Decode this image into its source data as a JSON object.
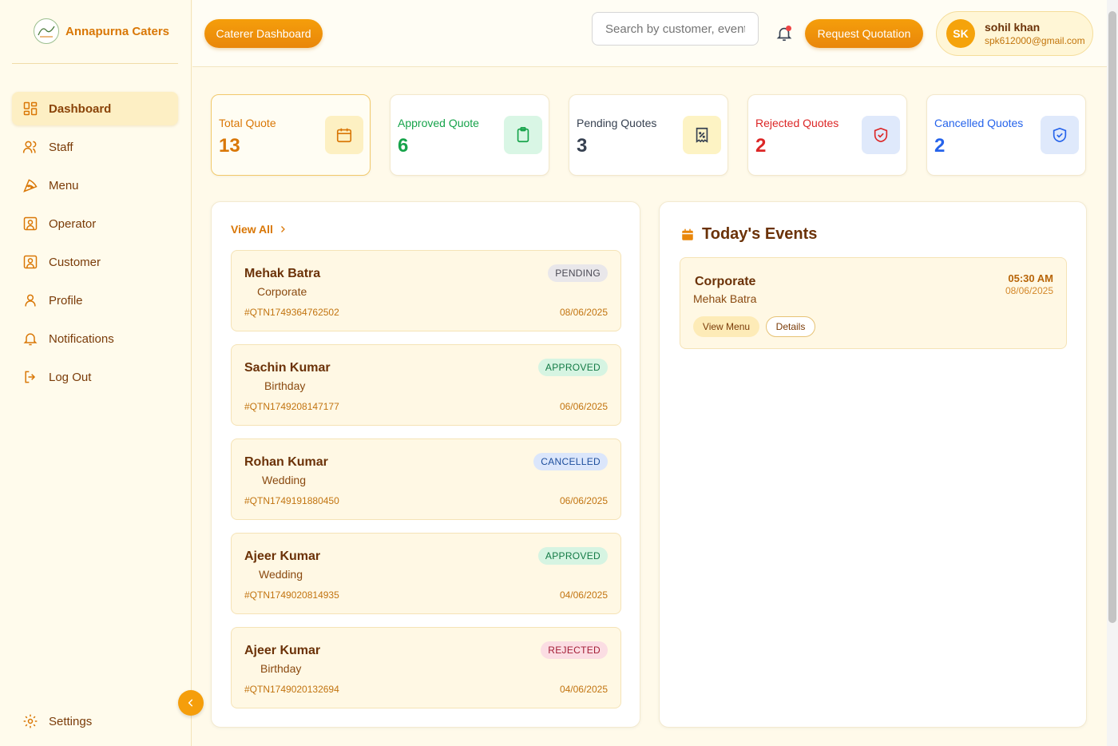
{
  "brand": {
    "name": "Annapurna Caters",
    "logo_text": "Annapurna"
  },
  "sidebar": {
    "items": [
      {
        "label": "Dashboard",
        "icon": "dashboard-icon"
      },
      {
        "label": "Staff",
        "icon": "users-icon"
      },
      {
        "label": "Menu",
        "icon": "pizza-icon"
      },
      {
        "label": "Operator",
        "icon": "id-card-icon"
      },
      {
        "label": "Customer",
        "icon": "id-card-icon"
      },
      {
        "label": "Profile",
        "icon": "user-icon"
      },
      {
        "label": "Notifications",
        "icon": "bell-icon"
      },
      {
        "label": "Log Out",
        "icon": "logout-icon"
      }
    ],
    "settings_label": "Settings"
  },
  "header": {
    "dashboard_button": "Caterer Dashboard",
    "search_placeholder": "Search by customer, event...",
    "request_button": "Request Quotation",
    "user": {
      "initials": "SK",
      "name": "sohil khan",
      "email": "spk612000@gmail.com"
    }
  },
  "stats": [
    {
      "label": "Total Quote",
      "value": "13",
      "color": "#d97706",
      "icon_bg": "#fdf0c2"
    },
    {
      "label": "Approved Quote",
      "value": "6",
      "color": "#16a34a",
      "icon_bg": "#d9f6e5"
    },
    {
      "label": "Pending Quotes",
      "value": "3",
      "color": "#374151",
      "icon_bg": "#fdf3c4"
    },
    {
      "label": "Rejected Quotes",
      "value": "2",
      "color": "#dc2626",
      "icon_bg": "#dfe9fb"
    },
    {
      "label": "Cancelled Quotes",
      "value": "2",
      "color": "#2563eb",
      "icon_bg": "#dfe9fb"
    }
  ],
  "quotes": {
    "view_all": "View All",
    "items": [
      {
        "name": "Mehak Batra",
        "type": "Corporate",
        "id": "#QTN1749364762502",
        "date": "08/06/2025",
        "status": "PENDING"
      },
      {
        "name": "Sachin Kumar",
        "type": "Birthday",
        "id": "#QTN1749208147177",
        "date": "06/06/2025",
        "status": "APPROVED"
      },
      {
        "name": "Rohan Kumar",
        "type": "Wedding",
        "id": "#QTN1749191880450",
        "date": "06/06/2025",
        "status": "CANCELLED"
      },
      {
        "name": "Ajeer Kumar",
        "type": "Wedding",
        "id": "#QTN1749020814935",
        "date": "04/06/2025",
        "status": "APPROVED"
      },
      {
        "name": "Ajeer Kumar",
        "type": "Birthday",
        "id": "#QTN1749020132694",
        "date": "04/06/2025",
        "status": "REJECTED"
      }
    ]
  },
  "events": {
    "title": "Today's Events",
    "items": [
      {
        "type": "Corporate",
        "customer": "Mehak Batra",
        "time": "05:30 AM",
        "date": "08/06/2025",
        "menu_button": "View Menu",
        "details_button": "Details"
      }
    ]
  }
}
